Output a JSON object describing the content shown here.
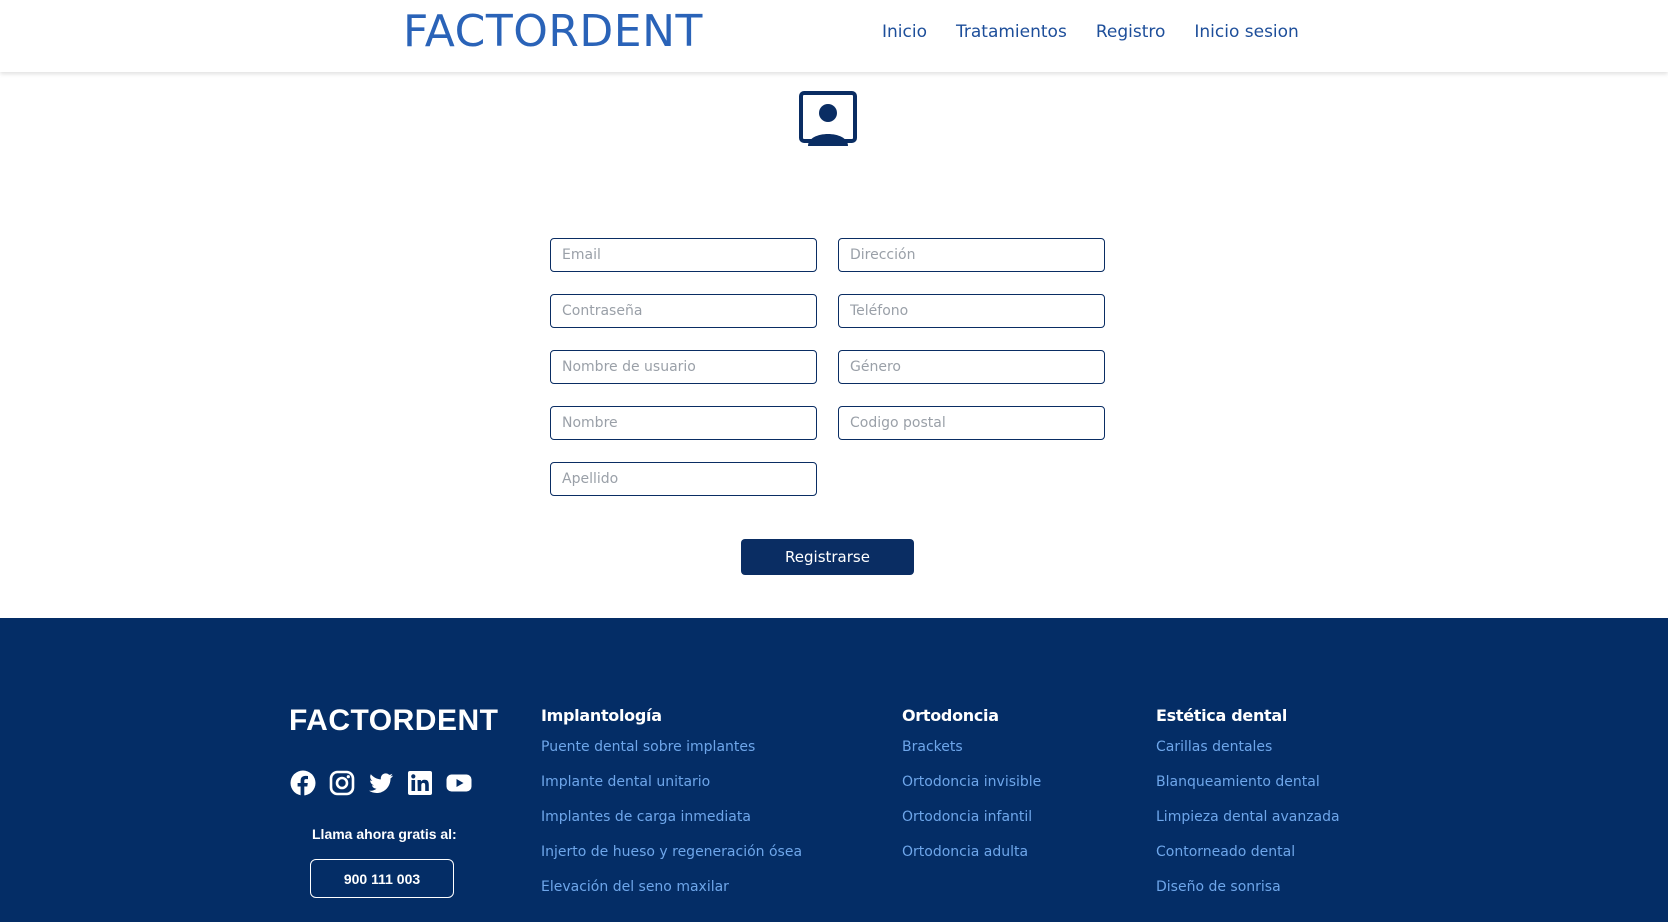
{
  "header": {
    "logo": "FACTORDENT",
    "nav": [
      "Inicio",
      "Tratamientos",
      "Registro",
      "Inicio sesion"
    ]
  },
  "form": {
    "left_fields": [
      "Email",
      "Contraseña",
      "Nombre de usuario",
      "Nombre",
      "Apellido"
    ],
    "right_fields": [
      "Dirección",
      "Teléfono",
      "Género",
      "Codigo postal"
    ],
    "submit_label": "Registrarse"
  },
  "footer": {
    "logo": "FACTORDENT",
    "socials": [
      "facebook-icon",
      "instagram-icon",
      "twitter-icon",
      "linkedin-icon",
      "youtube-icon"
    ],
    "call_label": "Llama ahora gratis al:",
    "phone": "900 111 003",
    "columns": [
      {
        "title": "Implantología",
        "links": [
          "Puente dental sobre implantes",
          "Implante dental unitario",
          "Implantes de carga inmediata",
          "Injerto de hueso y regeneración ósea",
          "Elevación del seno maxilar"
        ]
      },
      {
        "title": "Ortodoncia",
        "links": [
          "Brackets",
          "Ortodoncia invisible",
          "Ortodoncia infantil",
          "Ortodoncia adulta"
        ]
      },
      {
        "title": "Estética dental",
        "links": [
          "Carillas dentales",
          "Blanqueamiento dental",
          "Limpieza dental avanzada",
          "Contorneado dental",
          "Diseño de sonrisa"
        ]
      }
    ]
  },
  "colors": {
    "brand": "#2a63b8",
    "primary_dark": "#0a2d63",
    "footer_bg": "#042d66",
    "footer_link": "#6ea6ea"
  }
}
